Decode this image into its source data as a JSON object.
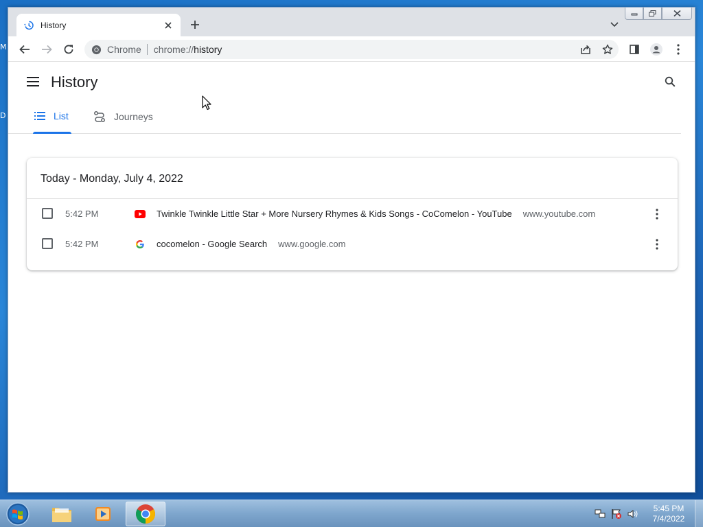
{
  "desktop": {
    "edge_text_1": "M",
    "edge_text_2": "D"
  },
  "browser": {
    "tab": {
      "title": "History",
      "icon": "history-icon"
    },
    "address": {
      "chip": "Chrome",
      "url_scheme": "chrome://",
      "url_host": "history"
    }
  },
  "history_page": {
    "title": "History",
    "tabs": [
      {
        "label": "List",
        "icon": "list-icon",
        "active": true
      },
      {
        "label": "Journeys",
        "icon": "journeys-icon",
        "active": false
      }
    ],
    "day_header": "Today - Monday, July 4, 2022",
    "entries": [
      {
        "time": "5:42 PM",
        "favicon": "youtube-icon",
        "title": "Twinkle Twinkle Little Star + More Nursery Rhymes & Kids Songs - CoComelon - YouTube",
        "domain": "www.youtube.com"
      },
      {
        "time": "5:42 PM",
        "favicon": "google-icon",
        "title": "cocomelon - Google Search",
        "domain": "www.google.com"
      }
    ]
  },
  "taskbar": {
    "clock_time": "5:45 PM",
    "clock_date": "7/4/2022"
  },
  "colors": {
    "accent": "#1a73e8",
    "youtube_red": "#ff0000"
  }
}
